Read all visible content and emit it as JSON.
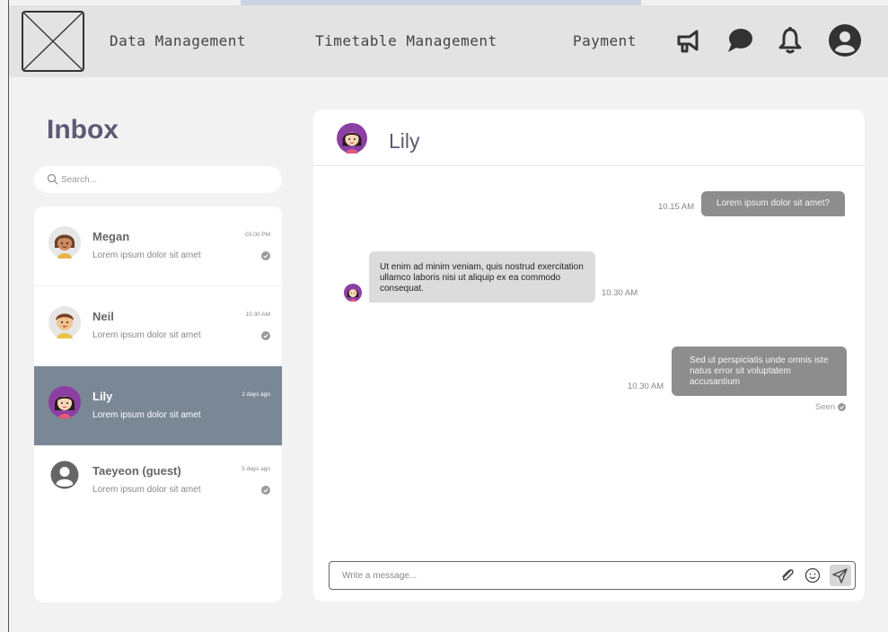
{
  "navbar": {
    "links": [
      {
        "label": "Data Management"
      },
      {
        "label": "Timetable Management"
      },
      {
        "label": "Payment"
      }
    ],
    "icons": [
      "megaphone-icon",
      "chat-bubble-icon",
      "bell-icon",
      "user-avatar-icon"
    ]
  },
  "inbox": {
    "title": "Inbox",
    "search_placeholder": "Search..."
  },
  "conversations": [
    {
      "name": "Megan",
      "preview": "Lorem ipsum dolor sit amet",
      "time": "03.00 PM",
      "read": true
    },
    {
      "name": "Neil",
      "preview": "Lorem ipsum dolor sit amet",
      "time": "10.30 AM",
      "read": true
    },
    {
      "name": "Lily",
      "preview": "Lorem ipsum dolor sit amet",
      "time": "2 days ago",
      "active": true
    },
    {
      "name": "Taeyeon (guest)",
      "preview": "Lorem ipsum dolor sit amet",
      "time": "5 days ago",
      "read": true
    }
  ],
  "chat": {
    "contact_name": "Lily",
    "messages": [
      {
        "direction": "out",
        "text": "Lorem ipsum dolor sit amet?",
        "time": "10.15 AM"
      },
      {
        "direction": "in",
        "text": "Ut enim ad minim veniam, quis nostrud exercitation ullamco laboris nisi ut aliquip ex ea commodo consequat.",
        "time": "10.30 AM"
      },
      {
        "direction": "out",
        "text": "Sed ut perspiciatis unde omnis iste natus error sit voluptatem accusantium",
        "time": "10.30 AM"
      }
    ],
    "seen_label": "Seen",
    "composer_placeholder": "Write a message..."
  },
  "colors": {
    "navbar_bg": "#e3e3e3",
    "page_bg": "#f2f2f2",
    "active_conversation": "#7a8795",
    "outgoing_bubble": "#8d8d8d",
    "incoming_bubble": "#dcdcdc",
    "title": "#5d5a72"
  }
}
